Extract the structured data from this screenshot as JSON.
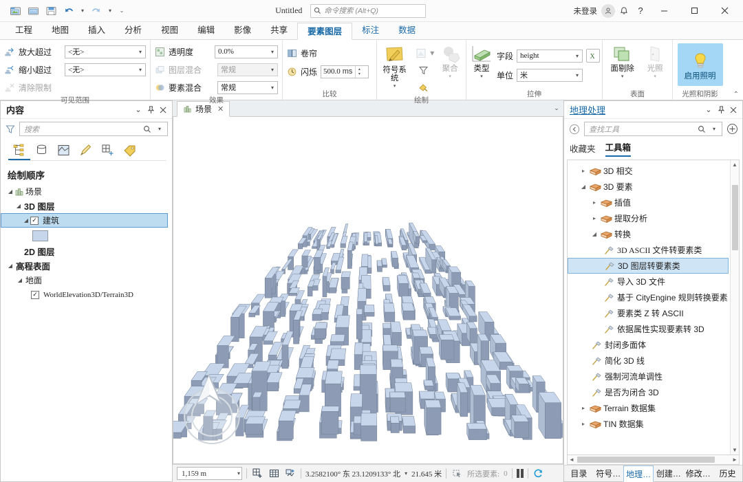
{
  "titlebar": {
    "doc_title": "Untitled",
    "search_placeholder": "命令搜索 (Alt+Q)",
    "account_label": "未登录",
    "qat": [
      {
        "name": "new-project",
        "label": "新建工程"
      },
      {
        "name": "open-project",
        "label": "打开工程"
      },
      {
        "name": "save-project",
        "label": "保存工程"
      },
      {
        "name": "undo",
        "label": "撤销"
      },
      {
        "name": "redo",
        "label": "恢复"
      },
      {
        "name": "customize-qat",
        "label": "自定义快速访问工具栏"
      }
    ],
    "window_controls": {
      "minimize": "—",
      "maximize": "☐",
      "close": "✕"
    },
    "help_label": "?"
  },
  "ribbon_tabs": [
    {
      "label": "工程",
      "active": false,
      "contextual": false
    },
    {
      "label": "地图",
      "active": false,
      "contextual": false
    },
    {
      "label": "插入",
      "active": false,
      "contextual": false
    },
    {
      "label": "分析",
      "active": false,
      "contextual": false
    },
    {
      "label": "视图",
      "active": false,
      "contextual": false
    },
    {
      "label": "编辑",
      "active": false,
      "contextual": false
    },
    {
      "label": "影像",
      "active": false,
      "contextual": false
    },
    {
      "label": "共享",
      "active": false,
      "contextual": false
    },
    {
      "label": "要素图层",
      "active": true,
      "contextual": true
    },
    {
      "label": "标注",
      "active": false,
      "contextual": true
    },
    {
      "label": "数据",
      "active": false,
      "contextual": true
    }
  ],
  "ribbon": {
    "groups": [
      {
        "name": "visible-range",
        "label": "可见范围",
        "rows": [
          {
            "label": "放大超过",
            "value": "<无>",
            "disabled": false
          },
          {
            "label": "缩小超过",
            "value": "<无>",
            "disabled": false
          },
          {
            "label": "清除限制",
            "value": "",
            "disabled": true
          }
        ]
      },
      {
        "name": "effects",
        "label": "效果",
        "rows": [
          {
            "label": "透明度",
            "value": "0.0%",
            "disabled": false
          },
          {
            "label": "图层混合",
            "value": "常规",
            "disabled": true
          },
          {
            "label": "要素混合",
            "value": "常规",
            "disabled": true
          }
        ]
      },
      {
        "name": "compare",
        "label": "比较",
        "swipe_label": "卷帘",
        "flicker_label": "闪烁",
        "flicker_value": "500.0",
        "flicker_unit": "ms"
      },
      {
        "name": "drawing",
        "label": "绘制",
        "symbology_label": "符号系统",
        "aggregation_label": "聚合"
      },
      {
        "name": "extrusion",
        "label": "拉伸",
        "type_label": "类型",
        "field_label": "字段",
        "field_value": "height",
        "unit_label": "单位",
        "unit_value": "米"
      },
      {
        "name": "surface",
        "label": "表面",
        "face_cull_label": "面剔除",
        "lighting_label": "光照"
      },
      {
        "name": "light-shadow",
        "label": "光照和阴影",
        "enable_lighting_label": "启用照明"
      }
    ]
  },
  "contents_panel": {
    "title": "内容",
    "search_placeholder": "搜索",
    "toolbar_icons": [
      {
        "name": "list-by-drawing-order-icon",
        "active": true
      },
      {
        "name": "list-by-data-source-icon",
        "active": false
      },
      {
        "name": "list-by-selection-icon",
        "active": false
      },
      {
        "name": "list-by-editing-icon",
        "active": false
      },
      {
        "name": "list-by-snapping-icon",
        "active": false
      },
      {
        "name": "list-by-labeling-icon",
        "active": false
      }
    ],
    "heading": "绘制顺序",
    "tree": [
      {
        "label": "场景",
        "level": 0,
        "twisty": "down",
        "icon": "scene-icon",
        "bold": true
      },
      {
        "label": "3D 图层",
        "level": 1,
        "twisty": "down",
        "bold": true
      },
      {
        "label": "建筑",
        "level": 2,
        "twisty": "down",
        "checkbox": true,
        "checked": true,
        "selected": true
      },
      {
        "label": "",
        "level": 3,
        "swatch": "#c7d6ea"
      },
      {
        "label": "2D 图层",
        "level": 1,
        "twisty": "none",
        "bold": true
      },
      {
        "label": "高程表面",
        "level": 0,
        "twisty": "down",
        "bold": true
      },
      {
        "label": "地面",
        "level": 1,
        "twisty": "down"
      },
      {
        "label": "WorldElevation3D/Terrain3D",
        "level": 2,
        "checkbox": true,
        "checked": true,
        "mono": true
      }
    ]
  },
  "view": {
    "tab_label": "场景",
    "tab_close": "✕",
    "scene_description": "3D city buildings extruded by height"
  },
  "statusbar": {
    "scale_value": "1,159 m",
    "coordinates": "3.2582100° 东 23.1209133° 北",
    "elevation": "21.645 米",
    "selected_label": "所选要素:",
    "selected_count": "0",
    "icons": [
      {
        "name": "add-grid-icon"
      },
      {
        "name": "grid-icon"
      },
      {
        "name": "measure-icon"
      },
      {
        "name": "selection-icon"
      },
      {
        "name": "pause-drawing-icon"
      },
      {
        "name": "refresh-icon"
      }
    ]
  },
  "geoprocessing_panel": {
    "title": "地理处理",
    "search_placeholder": "查找工具",
    "tabs": [
      {
        "label": "收藏夹",
        "active": false
      },
      {
        "label": "工具箱",
        "active": true
      }
    ],
    "tree": [
      {
        "label": "3D 相交",
        "level": 1,
        "twisty": "right",
        "icon": "toolbox-icon",
        "mono_prefix": "3D"
      },
      {
        "label": "3D 要素",
        "level": 1,
        "twisty": "down",
        "icon": "toolbox-icon",
        "mono_prefix": "3D"
      },
      {
        "label": "插值",
        "level": 2,
        "twisty": "right",
        "icon": "toolbox-icon"
      },
      {
        "label": "提取分析",
        "level": 2,
        "twisty": "right",
        "icon": "toolbox-icon"
      },
      {
        "label": "转换",
        "level": 2,
        "twisty": "down",
        "icon": "toolbox-icon"
      },
      {
        "label": "3D ASCII 文件转要素类",
        "level": 3,
        "icon": "tool-icon"
      },
      {
        "label": "3D 图层转要素类",
        "level": 3,
        "icon": "tool-icon",
        "selected": true
      },
      {
        "label": "导入 3D 文件",
        "level": 3,
        "icon": "tool-icon"
      },
      {
        "label": "基于 CityEngine 规则转换要素",
        "level": 3,
        "icon": "tool-icon"
      },
      {
        "label": "要素类 Z 转 ASCII",
        "level": 3,
        "icon": "tool-icon"
      },
      {
        "label": "依据属性实现要素转 3D",
        "level": 3,
        "icon": "tool-icon"
      },
      {
        "label": "封闭多面体",
        "level": 2,
        "icon": "tool-icon"
      },
      {
        "label": "简化 3D 线",
        "level": 2,
        "icon": "tool-icon"
      },
      {
        "label": "强制河流单调性",
        "level": 2,
        "icon": "tool-icon"
      },
      {
        "label": "是否为闭合 3D",
        "level": 2,
        "icon": "tool-icon"
      },
      {
        "label": "Terrain 数据集",
        "level": 1,
        "twisty": "right",
        "icon": "toolbox-icon"
      },
      {
        "label": "TIN 数据集",
        "level": 1,
        "twisty": "right",
        "icon": "toolbox-icon"
      }
    ],
    "bottom_tabs": [
      {
        "label": "目录",
        "active": false
      },
      {
        "label": "符号…",
        "active": false
      },
      {
        "label": "地理…",
        "active": true
      },
      {
        "label": "创建…",
        "active": false
      },
      {
        "label": "修改…",
        "active": false
      },
      {
        "label": "历史",
        "active": false
      }
    ]
  },
  "colors": {
    "accent": "#1a6aa8",
    "selection": "#bedcf0",
    "highlight": "#a3d7f5",
    "building": "#c7d6ea"
  }
}
